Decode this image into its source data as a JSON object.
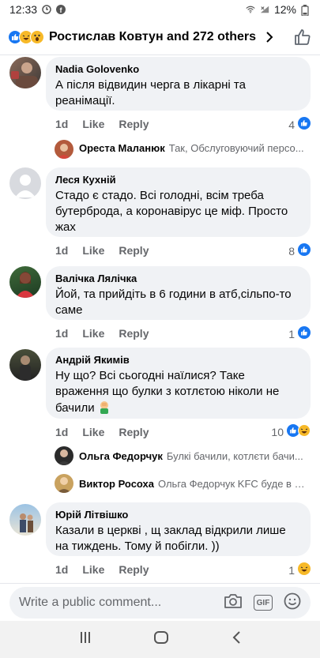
{
  "status_bar": {
    "time": "12:33",
    "battery": "12%"
  },
  "header": {
    "title": "Ростислав Ковтун and 272 others",
    "reactions": [
      "like-reaction-icon",
      "haha-reaction-icon",
      "wow-reaction-icon"
    ]
  },
  "comments": [
    {
      "author": "Nadia Golovenko",
      "text": "А після відвидин черга в лікарні та реанімації.",
      "time": "1d",
      "like_label": "Like",
      "reply_label": "Reply",
      "reactions_count": "4",
      "reply_preview": {
        "author": "Ореста Маланюк",
        "text": "Так, Обслуговуючий персо..."
      }
    },
    {
      "author": "Леся Кухній",
      "text": "Стадо є стадо. Всі голодні, всім треба бутерброда, а коронавірус це міф. Просто жах",
      "time": "1d",
      "like_label": "Like",
      "reply_label": "Reply",
      "reactions_count": "8"
    },
    {
      "author": "Валічка Лялічка",
      "text": "Йой, та прийдіть в 6 години в атб,сільпо-то саме",
      "time": "1d",
      "like_label": "Like",
      "reply_label": "Reply",
      "reactions_count": "1"
    },
    {
      "author": "Андрій Якимів",
      "text": "Ну що? Всі сьогодні наїлися? Таке враження що булки з котлєтою ніколи не бачили",
      "time": "1d",
      "like_label": "Like",
      "reply_label": "Reply",
      "reactions_count": "10",
      "replies": [
        {
          "author": "Ольга Федорчук",
          "text": "Булкі бачили, котлєти бачи..."
        },
        {
          "author": "Виктор Росоха",
          "text": "Ольга Федорчук KFC буде в н..."
        }
      ]
    },
    {
      "author": "Юрій Літвішко",
      "text": "Казали в церкві , щ заклад відкрили лише на тиждень. Тому й побігли. ))",
      "time": "1d",
      "like_label": "Like",
      "reply_label": "Reply",
      "reactions_count": "1"
    }
  ],
  "composer": {
    "placeholder": "Write a public comment...",
    "gif_label": "GIF"
  },
  "colors": {
    "facebook_blue": "#1877f2",
    "bubble_bg": "#f0f2f5",
    "secondary_text": "#65676b",
    "haha_yellow": "#f7b928"
  }
}
